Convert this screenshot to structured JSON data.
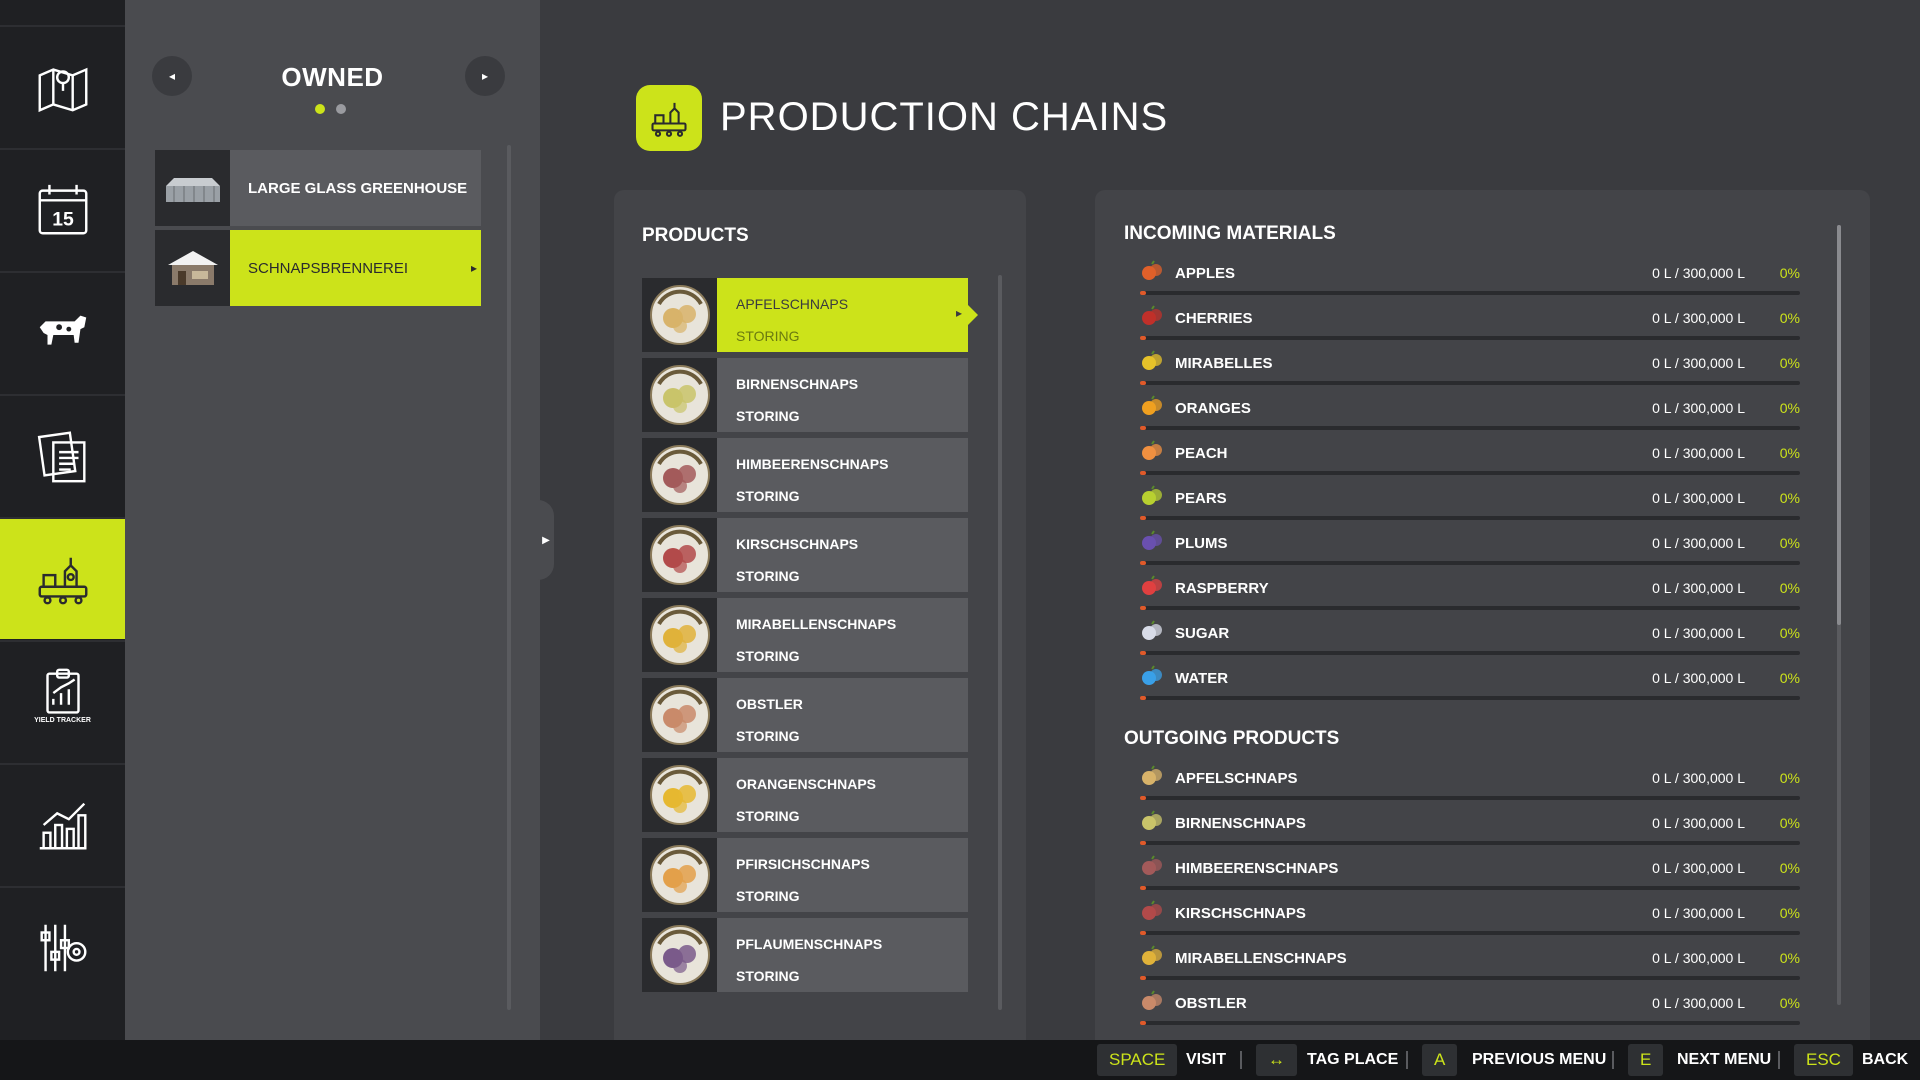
{
  "nav": {
    "items": [
      {
        "name": "map",
        "icon": "map-icon"
      },
      {
        "name": "calendar",
        "icon": "calendar-icon",
        "day": "15"
      },
      {
        "name": "animals",
        "icon": "cow-icon"
      },
      {
        "name": "contracts",
        "icon": "documents-icon"
      },
      {
        "name": "production",
        "icon": "factory-icon",
        "active": true
      },
      {
        "name": "yield-tracker",
        "icon": "yield-tracker-icon",
        "caption": "YIELD TRACKER"
      },
      {
        "name": "statistics",
        "icon": "bar-chart-icon"
      },
      {
        "name": "settings",
        "icon": "settings-icon"
      }
    ]
  },
  "owned": {
    "title": "OWNED",
    "prev_icon": "◂",
    "next_icon": "▸",
    "page_count": 2,
    "current_page": 1,
    "items": [
      {
        "label": "LARGE GLASS GREENHOUSE",
        "active": false
      },
      {
        "label": "SCHNAPSBRENNEREI",
        "active": true
      }
    ]
  },
  "header": {
    "title": "PRODUCTION CHAINS"
  },
  "products": {
    "title": "PRODUCTS",
    "items": [
      {
        "name": "APFELSCHNAPS",
        "status": "STORING",
        "active": true,
        "color": "#d8b36a"
      },
      {
        "name": "BIRNENSCHNAPS",
        "status": "STORING",
        "active": false,
        "color": "#c9c46a"
      },
      {
        "name": "HIMBEERENSCHNAPS",
        "status": "STORING",
        "active": false,
        "color": "#a35a5a"
      },
      {
        "name": "KIRSCHSCHNAPS",
        "status": "STORING",
        "active": false,
        "color": "#b24a4a"
      },
      {
        "name": "MIRABELLENSCHNAPS",
        "status": "STORING",
        "active": false,
        "color": "#e0b23a"
      },
      {
        "name": "OBSTLER",
        "status": "STORING",
        "active": false,
        "color": "#c98a6a"
      },
      {
        "name": "ORANGENSCHNAPS",
        "status": "STORING",
        "active": false,
        "color": "#e6b830"
      },
      {
        "name": "PFIRSICHSCHNAPS",
        "status": "STORING",
        "active": false,
        "color": "#e3a04a"
      },
      {
        "name": "PFLAUMENSCHNAPS",
        "status": "STORING",
        "active": false,
        "color": "#7a5a8a"
      }
    ]
  },
  "incoming": {
    "title": "INCOMING MATERIALS",
    "items": [
      {
        "name": "APPLES",
        "amount": "0 L / 300,000 L",
        "percent": "0%",
        "fill": 0,
        "icon": "apple-icon",
        "color": "#e0602a"
      },
      {
        "name": "CHERRIES",
        "amount": "0 L / 300,000 L",
        "percent": "0%",
        "fill": 0,
        "icon": "cherries-icon",
        "color": "#c0302a"
      },
      {
        "name": "MIRABELLES",
        "amount": "0 L / 300,000 L",
        "percent": "0%",
        "fill": 0,
        "icon": "mirabelles-icon",
        "color": "#e6c22a"
      },
      {
        "name": "ORANGES",
        "amount": "0 L / 300,000 L",
        "percent": "0%",
        "fill": 0,
        "icon": "orange-icon",
        "color": "#f0a020"
      },
      {
        "name": "PEACH",
        "amount": "0 L / 300,000 L",
        "percent": "0%",
        "fill": 0,
        "icon": "peach-icon",
        "color": "#f09040"
      },
      {
        "name": "PEARS",
        "amount": "0 L / 300,000 L",
        "percent": "0%",
        "fill": 0,
        "icon": "pear-icon",
        "color": "#b8d030"
      },
      {
        "name": "PLUMS",
        "amount": "0 L / 300,000 L",
        "percent": "0%",
        "fill": 0,
        "icon": "plum-icon",
        "color": "#6a50b0"
      },
      {
        "name": "RASPBERRY",
        "amount": "0 L / 300,000 L",
        "percent": "0%",
        "fill": 0,
        "icon": "raspberry-icon",
        "color": "#e04040"
      },
      {
        "name": "SUGAR",
        "amount": "0 L / 300,000 L",
        "percent": "0%",
        "fill": 0,
        "icon": "sugar-icon",
        "color": "#d8dce8"
      },
      {
        "name": "WATER",
        "amount": "0 L / 300,000 L",
        "percent": "0%",
        "fill": 0,
        "icon": "water-drop-icon",
        "color": "#3aa0e8"
      }
    ]
  },
  "outgoing": {
    "title": "OUTGOING PRODUCTS",
    "items": [
      {
        "name": "APFELSCHNAPS",
        "amount": "0 L / 300,000 L",
        "percent": "0%",
        "fill": 0,
        "icon": "apfelschnaps-icon",
        "color": "#d8b36a"
      },
      {
        "name": "BIRNENSCHNAPS",
        "amount": "0 L / 300,000 L",
        "percent": "0%",
        "fill": 0,
        "icon": "birnenschnaps-icon",
        "color": "#c9c46a"
      },
      {
        "name": "HIMBEERENSCHNAPS",
        "amount": "0 L / 300,000 L",
        "percent": "0%",
        "fill": 0,
        "icon": "himbeerenschnaps-icon",
        "color": "#a35a5a"
      },
      {
        "name": "KIRSCHSCHNAPS",
        "amount": "0 L / 300,000 L",
        "percent": "0%",
        "fill": 0,
        "icon": "kirschschnaps-icon",
        "color": "#b24a4a"
      },
      {
        "name": "MIRABELLENSCHNAPS",
        "amount": "0 L / 300,000 L",
        "percent": "0%",
        "fill": 0,
        "icon": "mirabellenschnaps-icon",
        "color": "#e0b23a"
      },
      {
        "name": "OBSTLER",
        "amount": "0 L / 300,000 L",
        "percent": "0%",
        "fill": 0,
        "icon": "obstler-icon",
        "color": "#c98a6a"
      }
    ]
  },
  "footer": {
    "actions": [
      {
        "key": "SPACE",
        "label": "VISIT"
      },
      {
        "key": "↔",
        "label": "TAG PLACE"
      },
      {
        "key": "A",
        "label": "PREVIOUS MENU"
      },
      {
        "key": "E",
        "label": "NEXT MENU"
      },
      {
        "key": "ESC",
        "label": "BACK"
      }
    ]
  },
  "colors": {
    "accent": "#cce31a",
    "bar_fill": "#e05a2a",
    "panel": "#434448",
    "nav": "#1f2023"
  }
}
